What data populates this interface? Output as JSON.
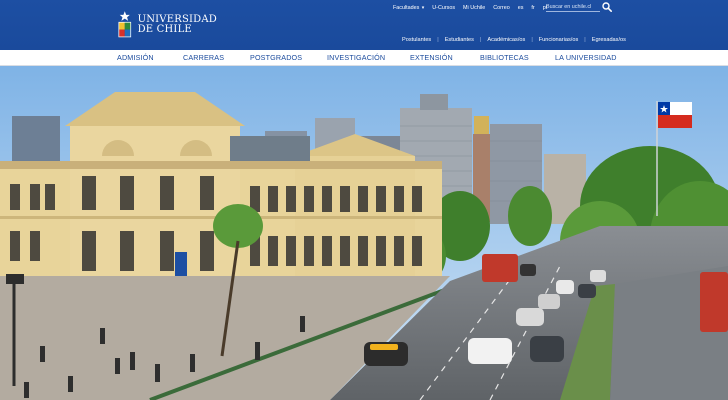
{
  "brand": {
    "name_line1": "UNIVERSIDAD",
    "name_line2": "DE CHILE"
  },
  "utility": {
    "faculties": "Facultades",
    "ucursos": "U-Cursos",
    "miuchile": "Mi Uchile",
    "correo": "Correo",
    "lang_es": "es",
    "lang_fr": "fr",
    "lang_pt": "pt",
    "search_placeholder": "Buscar en uchile.cl"
  },
  "audience": {
    "items": [
      "Postulantes",
      "Estudiantes",
      "Académicas/os",
      "Funcionarias/os",
      "Egresadas/os"
    ]
  },
  "nav": {
    "items": [
      "ADMISIÓN",
      "CARRERAS",
      "POSTGRADOS",
      "INVESTIGACIÓN",
      "EXTENSIÓN",
      "BIBLIOTECAS",
      "LA UNIVERSIDAD"
    ]
  },
  "colors": {
    "brand_blue": "#1a4a9c",
    "nav_text": "#1a4a9c",
    "facade": "#e8d49a"
  },
  "icons": {
    "search": "search-icon",
    "caret": "chevron-down-icon",
    "logo": "university-seal-icon"
  }
}
